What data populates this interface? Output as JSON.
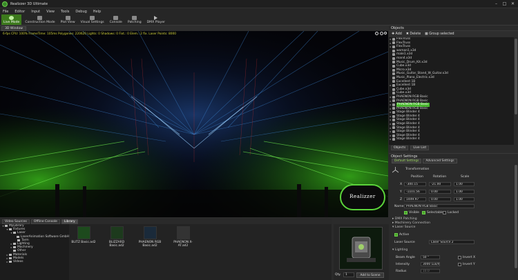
{
  "app": {
    "title": "Realizzer 3D Ultimate",
    "window_controls": [
      "–",
      "□",
      "✕"
    ]
  },
  "menu": [
    "File",
    "Editor",
    "Input",
    "View",
    "Tools",
    "Debug",
    "Help"
  ],
  "toolbar": [
    {
      "label": "Live Mode",
      "icon": "eye-icon",
      "active": true
    },
    {
      "label": "Construction Mode",
      "icon": "hammer-icon"
    },
    {
      "label": "Plot View",
      "icon": "grid-icon"
    },
    {
      "label": "Visual Settings",
      "icon": "monitor-icon"
    },
    {
      "label": "Console",
      "icon": "terminal-icon"
    },
    {
      "label": "Patching",
      "icon": "patch-icon"
    },
    {
      "label": "DMX Player",
      "icon": "play-icon"
    }
  ],
  "viewport": {
    "tab": "3D Window",
    "info": "6-fps  CPU: 100%  FrameTime: 105ms  Polygones: 220620  Lights: 0  Shadows: 0  Fixt.: 0  Elem.: 2 fix.  Laser Points: 8000",
    "logo_text": "Realizzer"
  },
  "objects": {
    "title": "Objects",
    "add_label": "Add",
    "delete_label": "Delete",
    "group_label": "Group selected",
    "items": [
      {
        "label": "FlexTruss",
        "expand": "▸",
        "depth": 0
      },
      {
        "label": "FlexTruss",
        "expand": "▸",
        "depth": 0
      },
      {
        "label": "FlexTruss",
        "expand": "▸",
        "depth": 0
      },
      {
        "label": "woman1.x3d",
        "expand": "",
        "depth": 0
      },
      {
        "label": "male1.x3d",
        "expand": "",
        "depth": 0
      },
      {
        "label": "man4.x3d",
        "expand": "",
        "depth": 0
      },
      {
        "label": "Music_Drum_Kit.x3d",
        "expand": "",
        "depth": 0
      },
      {
        "label": "Cube.x3d",
        "expand": "",
        "depth": 0
      },
      {
        "label": "Micro.x3d",
        "expand": "",
        "depth": 0
      },
      {
        "label": "Music_Guitar_Stand_W_Guitar.x3d",
        "expand": "",
        "depth": 0
      },
      {
        "label": "Music_Piano_Electric.x3d",
        "expand": "",
        "depth": 0
      },
      {
        "label": "Excellent 1B",
        "expand": "",
        "depth": 0
      },
      {
        "label": "Excellent 1B",
        "expand": "▸",
        "depth": 0
      },
      {
        "label": "Cube.x3d",
        "expand": "",
        "depth": 0
      },
      {
        "label": "Cube.x3d",
        "expand": "",
        "depth": 0
      },
      {
        "label": "PHAENON RGB Basic",
        "expand": "▸",
        "depth": 0
      },
      {
        "label": "PHAENON RGB Basic",
        "expand": "▸",
        "depth": 0
      },
      {
        "label": "PHAENON RGB Basic",
        "expand": "▸",
        "depth": 0,
        "selected": true
      },
      {
        "label": "PHAENON RGB Basic",
        "expand": "▸",
        "depth": 0
      },
      {
        "label": "Stage Blinder 4",
        "expand": "▸",
        "depth": 0
      },
      {
        "label": "Stage Blinder 4",
        "expand": "▸",
        "depth": 0
      },
      {
        "label": "Stage Blinder 4",
        "expand": "▸",
        "depth": 0
      },
      {
        "label": "Stage Blinder 4",
        "expand": "▸",
        "depth": 0
      },
      {
        "label": "Stage Blinder 4",
        "expand": "▸",
        "depth": 0
      },
      {
        "label": "Stage Blinder 4",
        "expand": "▸",
        "depth": 0
      },
      {
        "label": "Stage Blinder 4",
        "expand": "▸",
        "depth": 0
      },
      {
        "label": "Stage Blinder 4",
        "expand": "▸",
        "depth": 0
      }
    ],
    "tabs": [
      "Objects",
      "Live List"
    ]
  },
  "object_settings": {
    "title": "Object Settings",
    "tabs": [
      "Default Settings",
      "Advanced Settings"
    ],
    "transformation_label": "Transformation",
    "col_position": "Position",
    "col_rotation": "Rotation",
    "col_scale": "Scale",
    "rows": [
      {
        "axis": "X",
        "position": "-300.15",
        "rotation": "-21.00",
        "scale": "1.00"
      },
      {
        "axis": "Y",
        "position": "-1101.56",
        "rotation": "0.00",
        "scale": "1.00"
      },
      {
        "axis": "Z",
        "position": "1449.97",
        "rotation": "0.00",
        "scale": "1.00"
      }
    ],
    "name_label": "Name",
    "name_value": "PHAENON RGB Basic",
    "visible_label": "Visible",
    "selectable_label": "Selectable",
    "locked_label": "Locked",
    "section_dmx": "DMX Patching",
    "section_machinery": "Machinery Connection",
    "section_laser": "Laser Source",
    "active_label": "Active",
    "laser_source_label": "Laser Source",
    "laser_source_value": "Laser Source 2",
    "section_lighting": "Lighting",
    "beam_angle_label": "Beam Angle",
    "beam_angle_value": "50 °",
    "intensity_label": "Intensity",
    "intensity_value": "3000 Lux/m",
    "radius_label": "Radius",
    "radius_value": "10.0",
    "invert_x_label": "Invert X",
    "invert_y_label": "Invert Y"
  },
  "bottom": {
    "tabs": [
      "Video Sources",
      "Offline Console",
      "Library"
    ],
    "active_tab": 2,
    "tree": [
      {
        "label": "MyLibrary",
        "depth": 0,
        "expand": "▾"
      },
      {
        "label": "Fixtures",
        "depth": 1,
        "expand": "▾"
      },
      {
        "label": "Laser",
        "depth": 2,
        "expand": "▾"
      },
      {
        "label": "LaserAnimation Software GmbH",
        "depth": 3,
        "expand": ""
      },
      {
        "label": "Tarm",
        "depth": 3,
        "expand": ""
      },
      {
        "label": "Lighting",
        "depth": 2,
        "expand": "▸"
      },
      {
        "label": "Machinery",
        "depth": 2,
        "expand": "▸"
      },
      {
        "label": "Other",
        "depth": 2,
        "expand": ""
      },
      {
        "label": "Materials",
        "depth": 1,
        "expand": "▸"
      },
      {
        "label": "Models",
        "depth": 1,
        "expand": "▸"
      },
      {
        "label": "Videos",
        "depth": 1,
        "expand": "▸"
      }
    ],
    "thumbs": [
      {
        "label": "BLITZ Basic.ad2"
      },
      {
        "label": "BLIZZARD Basic.ad2"
      },
      {
        "label": "PHAENON RGB Basic.ad2"
      },
      {
        "label": "PHAENON X-AT.ad2"
      }
    ],
    "qty_label": "Qty.",
    "qty_value": "1",
    "add_button": "Add to Scene"
  },
  "colors": {
    "accent": "#45b52a",
    "background": "#2b2b2b",
    "viewport": "#040408"
  }
}
